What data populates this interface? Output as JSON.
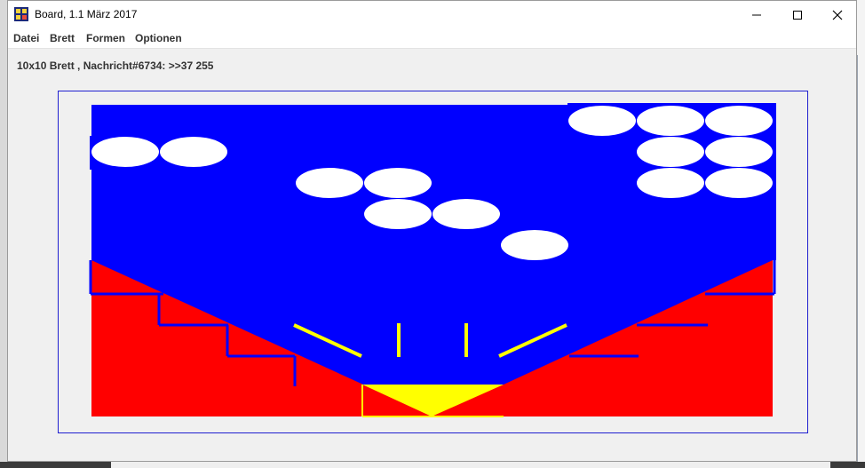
{
  "window": {
    "title": "Board, 1.1 März 2017",
    "app_icon": "board-icon"
  },
  "menu": [
    "Datei",
    "Brett",
    "Formen",
    "Optionen"
  ],
  "status": "10x10 Brett , Nachricht#6734: >>37 255",
  "colors": {
    "board_blue": "#0000ff",
    "slope_red": "#ff0000",
    "accent_yellow": "#ffff00",
    "ball_white": "#ffffff",
    "frame_border": "#1f1fd0"
  }
}
